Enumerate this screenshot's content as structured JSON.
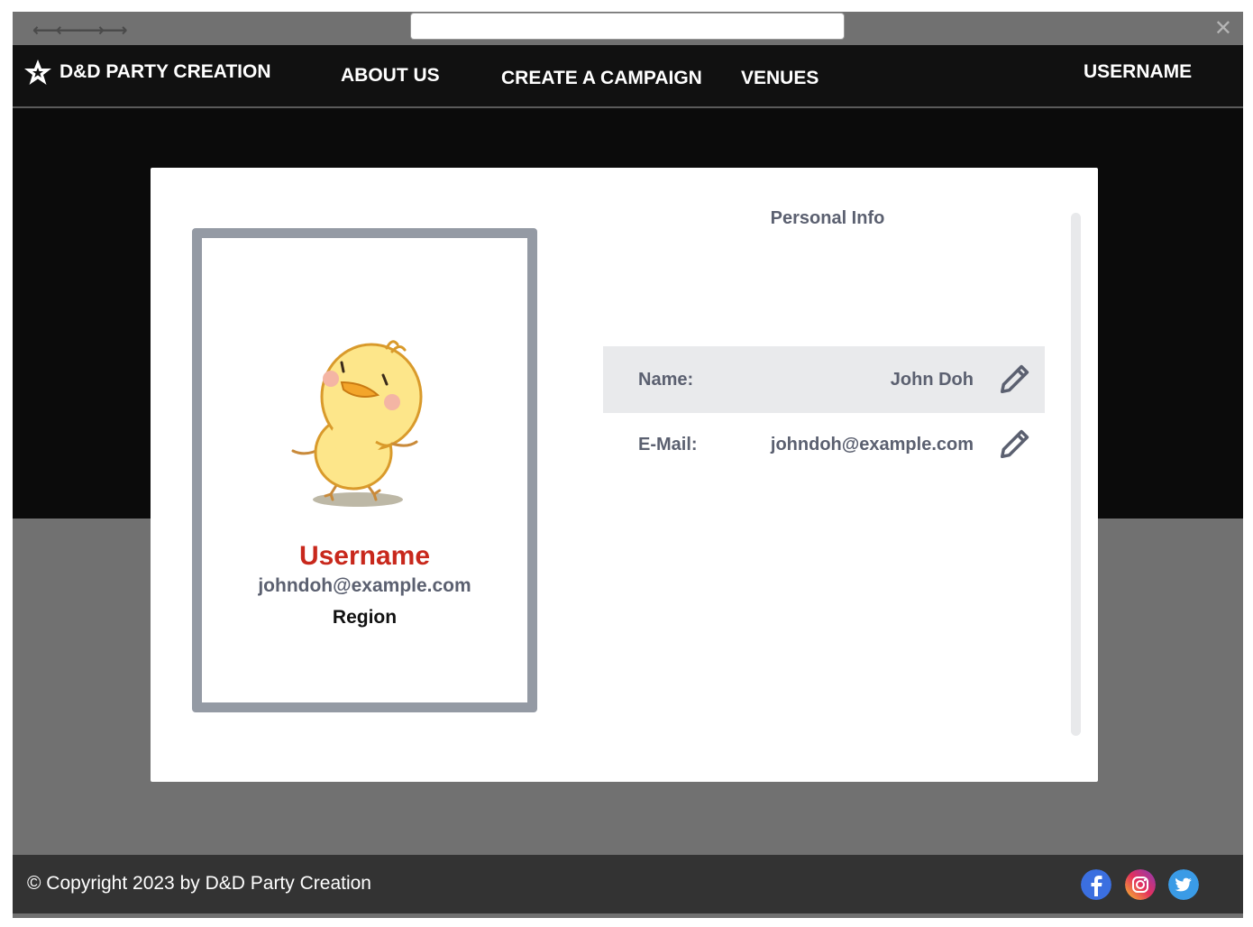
{
  "browser": {
    "back_forward_icon": "back-forward-arrows-icon",
    "close_icon": "close-x-icon"
  },
  "navbar": {
    "brand": "D&D PARTY CREATION",
    "brand_icon": "star-icon",
    "links": [
      "ABOUT US",
      "CREATE A CAMPAIGN",
      "VENUES"
    ],
    "user": "USERNAME"
  },
  "profile_card": {
    "avatar": "chick-avatar",
    "username": "Username",
    "email": "johndoh@example.com",
    "region": "Region"
  },
  "personal_info": {
    "title": "Personal Info",
    "rows": [
      {
        "label": "Name:",
        "value": "John Doh",
        "edit_icon": "pencil-icon"
      },
      {
        "label": "E-Mail:",
        "value": "johndoh@example.com",
        "edit_icon": "pencil-icon"
      }
    ]
  },
  "footer": {
    "copyright": "© Copyright 2023 by D&D Party Creation",
    "social": [
      "facebook-icon",
      "instagram-icon",
      "twitter-icon"
    ]
  },
  "colors": {
    "navbar_bg": "#111111",
    "accent_red": "#c8281c",
    "text_gray": "#5b6070",
    "footer_bg": "#333333"
  }
}
